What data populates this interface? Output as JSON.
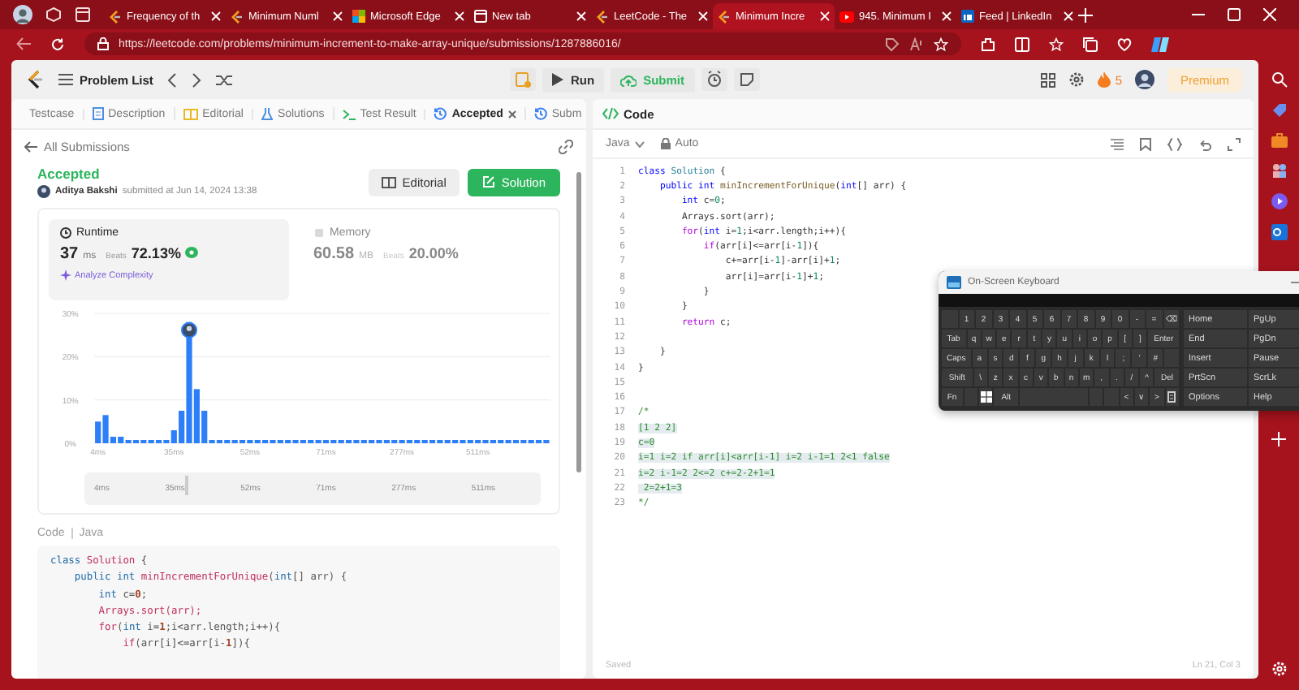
{
  "browser": {
    "tabs": [
      {
        "kind": "leetcode",
        "title": "Frequency of th",
        "selected": false
      },
      {
        "kind": "leetcode",
        "title": "Minimum Numl",
        "selected": false
      },
      {
        "kind": "edge",
        "title": "Microsoft Edge",
        "selected": false
      },
      {
        "kind": "newtab",
        "title": "New tab",
        "selected": false
      },
      {
        "kind": "leetcode",
        "title": "LeetCode - The",
        "selected": false
      },
      {
        "kind": "leetcode",
        "title": "Minimum Incre",
        "selected": true
      },
      {
        "kind": "youtube",
        "title": "945. Minimum I",
        "selected": false
      },
      {
        "kind": "linkedin",
        "title": "Feed | LinkedIn",
        "selected": false
      }
    ],
    "url": "https://leetcode.com/problems/minimum-increment-to-make-array-unique/submissions/1287886016/"
  },
  "header": {
    "problem_list": "Problem List",
    "run": "Run",
    "submit": "Submit",
    "streak": "5",
    "premium": "Premium"
  },
  "left_panel": {
    "tabs": [
      {
        "kind": "none",
        "label": "Testcase",
        "selected": false,
        "closable": false
      },
      {
        "kind": "description",
        "label": "Description",
        "selected": false,
        "closable": false
      },
      {
        "kind": "editorial",
        "label": "Editorial",
        "selected": false,
        "closable": false
      },
      {
        "kind": "solutions",
        "label": "Solutions",
        "selected": false,
        "closable": false
      },
      {
        "kind": "result",
        "label": "Test Result",
        "selected": false,
        "closable": false
      },
      {
        "kind": "history",
        "label": "Accepted",
        "selected": true,
        "closable": true
      },
      {
        "kind": "history",
        "label": "Subm",
        "selected": false,
        "closable": false
      }
    ],
    "back": "All Submissions",
    "status": "Accepted",
    "author": "Aditya Bakshi",
    "submitted": "submitted at Jun 14, 2024 13:38",
    "editorial_button": "Editorial",
    "solution_button": "Solution",
    "metrics": [
      {
        "kind": "clock",
        "label": "Runtime",
        "value": "37",
        "unit": "ms",
        "beats_label": "Beats",
        "beats": "72.13%",
        "selected": true,
        "analyze": "Analyze Complexity"
      },
      {
        "kind": "chip",
        "label": "Memory",
        "value": "60.58",
        "unit": "MB",
        "beats_label": "Beats",
        "beats": "20.00%",
        "selected": false
      }
    ],
    "chart_data": {
      "type": "bar",
      "categories": [
        "4ms",
        null,
        null,
        null,
        null,
        null,
        null,
        null,
        null,
        null,
        "35ms",
        null,
        null,
        null,
        null,
        null,
        null,
        null,
        null,
        null,
        "52ms",
        null,
        null,
        null,
        null,
        null,
        null,
        null,
        null,
        null,
        "71ms",
        null,
        null,
        null,
        null,
        null,
        null,
        null,
        null,
        null,
        "277ms",
        null,
        null,
        null,
        null,
        null,
        null,
        null,
        null,
        null,
        "511ms",
        null,
        null,
        null,
        null,
        null,
        null,
        null,
        null,
        null
      ],
      "values": [
        5,
        6.5,
        1.5,
        1.5,
        0.75,
        0.75,
        0.75,
        0.75,
        0.75,
        0.75,
        3,
        7.5,
        28,
        12.5,
        7.5,
        0.75,
        0.75,
        0.75,
        0.75,
        0.75,
        0.75,
        0.75,
        0.75,
        0.75,
        0.75,
        0.75,
        0.75,
        0.75,
        0.75,
        0.75,
        0.75,
        0.75,
        0.75,
        0.75,
        0.75,
        0.75,
        0.75,
        0.75,
        0.75,
        0.75,
        0.75,
        0.75,
        0.75,
        0.75,
        0.75,
        0.75,
        0.75,
        0.75,
        0.75,
        0.75,
        0.75,
        0.75,
        0.75,
        0.75,
        0.75,
        0.75,
        0.75,
        0.75,
        0.75,
        0.75
      ],
      "ylim": [
        0,
        30
      ],
      "yticks": [
        {
          "value": 0,
          "label": "0%"
        },
        {
          "value": 10,
          "label": "10%"
        },
        {
          "value": 20,
          "label": "20%"
        },
        {
          "value": 30,
          "label": "30%"
        }
      ]
    },
    "range_slider": {
      "level": 0.22,
      "labels": [
        "4ms",
        "35ms",
        "52ms",
        "71ms",
        "277ms",
        "511ms"
      ]
    },
    "code_label": "Code",
    "code_language": "Java",
    "code_lines": [
      [
        {
          "text": "class ",
          "kind": "kw"
        },
        {
          "text": "Solution",
          "kind": "type"
        },
        {
          "text": " {",
          "kind": "pl"
        }
      ],
      [
        {
          "text": "    public int ",
          "kind": "kw"
        },
        {
          "text": "minIncrementForUnique",
          "kind": "type"
        },
        {
          "text": "(",
          "kind": "pl"
        },
        {
          "text": "int",
          "kind": "kw"
        },
        {
          "text": "[] arr) {",
          "kind": "pl"
        }
      ],
      [
        {
          "text": "        int ",
          "kind": "kw"
        },
        {
          "text": "c=",
          "kind": "pl"
        },
        {
          "text": "0",
          "kind": "num"
        },
        {
          "text": ";",
          "kind": "pl"
        }
      ],
      [
        {
          "text": "        Arrays",
          "kind": "type"
        },
        {
          "text": ".sort(arr);",
          "kind": "type"
        }
      ],
      [
        {
          "text": "        for",
          "kind": "type"
        },
        {
          "text": "(",
          "kind": "pl"
        },
        {
          "text": "int",
          "kind": "kw"
        },
        {
          "text": " i=",
          "kind": "pl"
        },
        {
          "text": "1",
          "kind": "num"
        },
        {
          "text": ";i<arr.length;i++){",
          "kind": "pl"
        }
      ],
      [
        {
          "text": "            if",
          "kind": "type"
        },
        {
          "text": "(arr[i]<=arr[i-",
          "kind": "pl"
        },
        {
          "text": "1",
          "kind": "num"
        },
        {
          "text": "]){",
          "kind": "pl"
        }
      ]
    ]
  },
  "editor": {
    "title": "Code",
    "language": "Java",
    "mode": "Auto",
    "status": "Saved",
    "cursor": "Ln 21, Col 3",
    "lines": [
      {
        "n": "1",
        "selected": false,
        "tokens": [
          {
            "text": "class ",
            "kind": "kw"
          },
          {
            "text": "Solution",
            "kind": "type"
          },
          {
            "text": " {",
            "kind": "pl"
          }
        ]
      },
      {
        "n": "2",
        "selected": false,
        "tokens": [
          {
            "text": "    public int ",
            "kind": "kw"
          },
          {
            "text": "minIncrementForUnique",
            "kind": "fn"
          },
          {
            "text": "(",
            "kind": "pl"
          },
          {
            "text": "int",
            "kind": "kw"
          },
          {
            "text": "[] arr) {",
            "kind": "pl"
          }
        ]
      },
      {
        "n": "3",
        "selected": false,
        "tokens": [
          {
            "text": "        int ",
            "kind": "kw"
          },
          {
            "text": "c=",
            "kind": "pl"
          },
          {
            "text": "0",
            "kind": "num"
          },
          {
            "text": ";",
            "kind": "pl"
          }
        ]
      },
      {
        "n": "4",
        "selected": false,
        "tokens": [
          {
            "text": "        Arrays.sort(arr);",
            "kind": "pl"
          }
        ]
      },
      {
        "n": "5",
        "selected": false,
        "tokens": [
          {
            "text": "        for",
            "kind": "ctrl"
          },
          {
            "text": "(",
            "kind": "pl"
          },
          {
            "text": "int",
            "kind": "kw"
          },
          {
            "text": " i=",
            "kind": "pl"
          },
          {
            "text": "1",
            "kind": "num"
          },
          {
            "text": ";i<arr.length;i++){",
            "kind": "pl"
          }
        ]
      },
      {
        "n": "6",
        "selected": false,
        "tokens": [
          {
            "text": "            if",
            "kind": "ctrl"
          },
          {
            "text": "(arr[i]<=arr[i-",
            "kind": "pl"
          },
          {
            "text": "1",
            "kind": "num"
          },
          {
            "text": "]){",
            "kind": "pl"
          }
        ]
      },
      {
        "n": "7",
        "selected": false,
        "tokens": [
          {
            "text": "                c+=arr[i-",
            "kind": "pl"
          },
          {
            "text": "1",
            "kind": "num"
          },
          {
            "text": "]-arr[i]+",
            "kind": "pl"
          },
          {
            "text": "1",
            "kind": "num"
          },
          {
            "text": ";",
            "kind": "pl"
          }
        ]
      },
      {
        "n": "8",
        "selected": false,
        "tokens": [
          {
            "text": "                arr[i]=arr[i-",
            "kind": "pl"
          },
          {
            "text": "1",
            "kind": "num"
          },
          {
            "text": "]+",
            "kind": "pl"
          },
          {
            "text": "1",
            "kind": "num"
          },
          {
            "text": ";",
            "kind": "pl"
          }
        ]
      },
      {
        "n": "9",
        "selected": false,
        "tokens": [
          {
            "text": "            }",
            "kind": "pl"
          }
        ]
      },
      {
        "n": "10",
        "selected": false,
        "tokens": [
          {
            "text": "        }",
            "kind": "pl"
          }
        ]
      },
      {
        "n": "11",
        "selected": false,
        "tokens": [
          {
            "text": "        return",
            "kind": "ctrl"
          },
          {
            "text": " c;",
            "kind": "pl"
          }
        ]
      },
      {
        "n": "12",
        "selected": false
      },
      {
        "n": "13",
        "selected": false,
        "tokens": [
          {
            "text": "    }",
            "kind": "pl"
          }
        ]
      },
      {
        "n": "14",
        "selected": false,
        "tokens": [
          {
            "text": "}",
            "kind": "pl"
          }
        ]
      },
      {
        "n": "15",
        "selected": false
      },
      {
        "n": "16",
        "selected": false
      },
      {
        "n": "17",
        "selected": false,
        "tokens": [
          {
            "text": "/*",
            "kind": "cm"
          }
        ]
      },
      {
        "n": "18",
        "selected": true,
        "tokens": [
          {
            "text": "[1 2 2]",
            "kind": "cm"
          }
        ]
      },
      {
        "n": "19",
        "selected": true,
        "tokens": [
          {
            "text": "c=0",
            "kind": "cm"
          }
        ]
      },
      {
        "n": "20",
        "selected": true,
        "tokens": [
          {
            "text": "i=1 i=2 if arr[i]<arr[i-1] i=2 i-1=1 2<1 false",
            "kind": "cm"
          }
        ]
      },
      {
        "n": "21",
        "selected": true,
        "tokens": [
          {
            "text": "i=2 i-1=2 2<=2 c+=2-2+1=1",
            "kind": "cm"
          }
        ]
      },
      {
        "n": "22",
        "selected": true,
        "tokens": [
          {
            "text": " 2=2+1=3",
            "kind": "cm"
          }
        ]
      },
      {
        "n": "23",
        "selected": false,
        "tokens": [
          {
            "text": "*/",
            "kind": "cm"
          }
        ]
      }
    ]
  },
  "keyboard": {
    "title": "On-Screen Keyboard",
    "rows": [
      [
        {
          "kind": "blank"
        },
        {
          "kind": "key",
          "label": "1"
        },
        {
          "kind": "key",
          "label": "2"
        },
        {
          "kind": "key",
          "label": "3"
        },
        {
          "kind": "key",
          "label": "4"
        },
        {
          "kind": "key",
          "label": "5"
        },
        {
          "kind": "key",
          "label": "6"
        },
        {
          "kind": "key",
          "label": "7"
        },
        {
          "kind": "key",
          "label": "8"
        },
        {
          "kind": "key",
          "label": "9"
        },
        {
          "kind": "key",
          "label": "0"
        },
        {
          "kind": "key",
          "label": "-"
        },
        {
          "kind": "key",
          "label": "="
        },
        {
          "kind": "key",
          "label": "⌫"
        }
      ],
      [
        {
          "kind": "key",
          "label": "Tab"
        },
        {
          "kind": "key",
          "label": "q"
        },
        {
          "kind": "key",
          "label": "w"
        },
        {
          "kind": "key",
          "label": "e"
        },
        {
          "kind": "key",
          "label": "r"
        },
        {
          "kind": "key",
          "label": "t"
        },
        {
          "kind": "key",
          "label": "y"
        },
        {
          "kind": "key",
          "label": "u"
        },
        {
          "kind": "key",
          "label": "i"
        },
        {
          "kind": "key",
          "label": "o"
        },
        {
          "kind": "key",
          "label": "p"
        },
        {
          "kind": "key",
          "label": "["
        },
        {
          "kind": "key",
          "label": "]"
        },
        {
          "kind": "key",
          "label": "Enter"
        }
      ],
      [
        {
          "kind": "key",
          "label": "Caps"
        },
        {
          "kind": "key",
          "label": "a"
        },
        {
          "kind": "key",
          "label": "s"
        },
        {
          "kind": "key",
          "label": "d"
        },
        {
          "kind": "key",
          "label": "f"
        },
        {
          "kind": "key",
          "label": "g"
        },
        {
          "kind": "key",
          "label": "h"
        },
        {
          "kind": "key",
          "label": "j"
        },
        {
          "kind": "key",
          "label": "k"
        },
        {
          "kind": "key",
          "label": "l"
        },
        {
          "kind": "key",
          "label": ";"
        },
        {
          "kind": "key",
          "label": "'"
        },
        {
          "kind": "key",
          "label": "#"
        },
        {
          "kind": "blank"
        }
      ],
      [
        {
          "kind": "key",
          "label": "Shift"
        },
        {
          "kind": "key",
          "label": "\\"
        },
        {
          "kind": "key",
          "label": "z"
        },
        {
          "kind": "key",
          "label": "x"
        },
        {
          "kind": "key",
          "label": "c"
        },
        {
          "kind": "key",
          "label": "v"
        },
        {
          "kind": "key",
          "label": "b"
        },
        {
          "kind": "key",
          "label": "n"
        },
        {
          "kind": "key",
          "label": "m"
        },
        {
          "kind": "key",
          "label": ","
        },
        {
          "kind": "key",
          "label": "."
        },
        {
          "kind": "key",
          "label": "/"
        },
        {
          "kind": "key",
          "label": "^"
        },
        {
          "kind": "key",
          "label": "Del"
        }
      ],
      [
        {
          "kind": "key",
          "label": "Fn"
        },
        {
          "kind": "blank"
        },
        {
          "kind": "windows"
        },
        {
          "kind": "key",
          "label": "Alt"
        },
        {
          "kind": "space"
        },
        {
          "kind": "blank"
        },
        {
          "kind": "blank"
        },
        {
          "kind": "key",
          "label": "<"
        },
        {
          "kind": "key",
          "label": "∨"
        },
        {
          "kind": "key",
          "label": ">"
        },
        {
          "kind": "menu"
        }
      ]
    ],
    "nav_keys": [
      "Home",
      "PgUp",
      "End",
      "PgDn",
      "Insert",
      "Pause",
      "PrtScn",
      "ScrLk",
      "Options",
      "Help"
    ]
  }
}
